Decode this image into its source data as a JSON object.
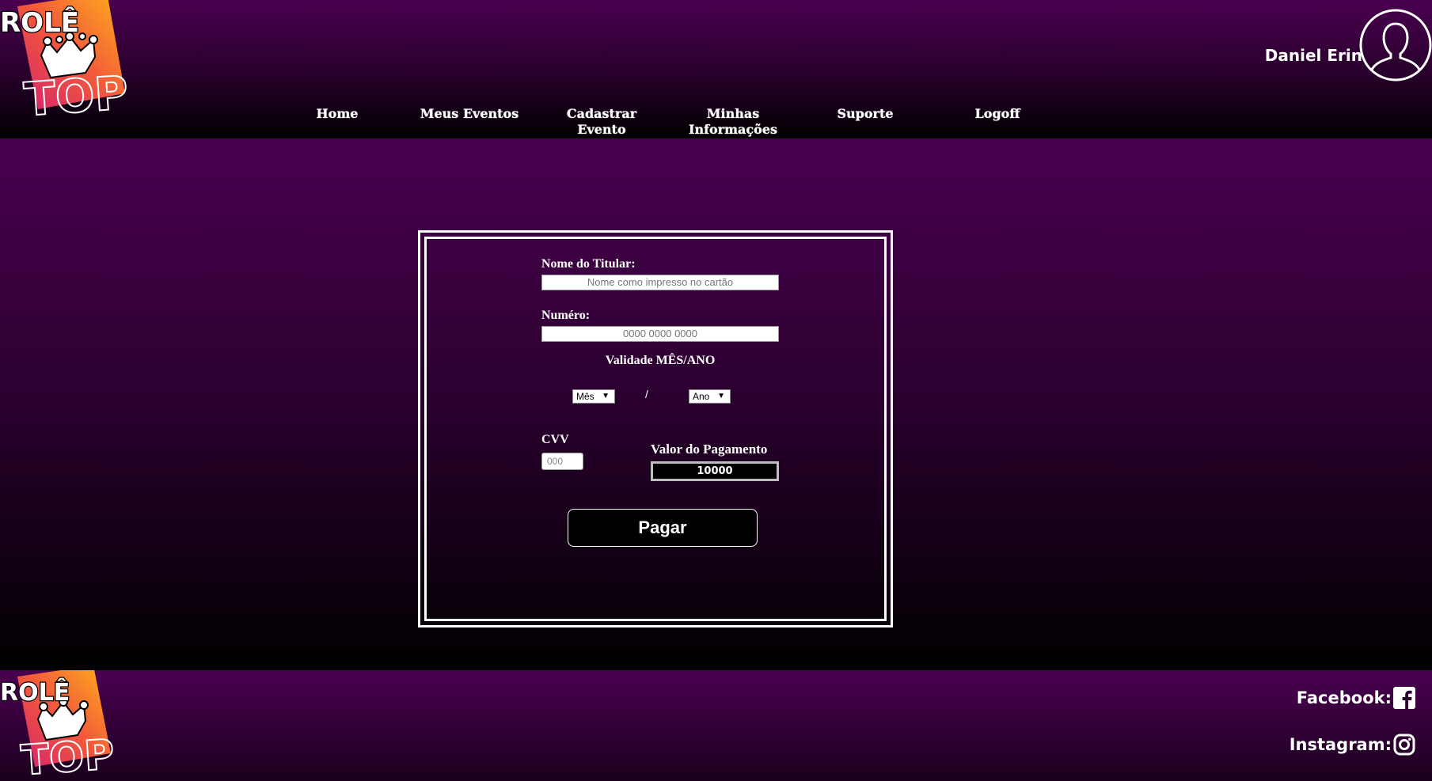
{
  "header": {
    "logo_top_text": "ROLÊ",
    "logo_bottom_text": "TOP",
    "user_name": "Daniel Erin",
    "nav": [
      {
        "label": "Home"
      },
      {
        "label": "Meus Eventos"
      },
      {
        "label": "Cadastrar Evento"
      },
      {
        "label": "Minhas Informações"
      },
      {
        "label": "Suporte"
      },
      {
        "label": "Logoff"
      }
    ]
  },
  "form": {
    "holder_label": "Nome do Titular:",
    "holder_placeholder": "Nome como impresso no cartão",
    "number_label": "Numéro:",
    "number_placeholder": "0000 0000 0000",
    "validity_label": "Validade MÊS/ANO",
    "month_selected": "Mês",
    "separator": "/",
    "year_selected": "Ano",
    "cvv_label": "CVV",
    "cvv_placeholder": "000",
    "amount_label": "Valor do Pagamento",
    "amount_value": "10000",
    "pay_label": "Pagar"
  },
  "footer": {
    "facebook_label": "Facebook:",
    "instagram_label": "Instagram:"
  },
  "colors": {
    "purple": "#4a0050",
    "logo_orange": "#ff9a1f",
    "logo_pink": "#e0306f"
  }
}
